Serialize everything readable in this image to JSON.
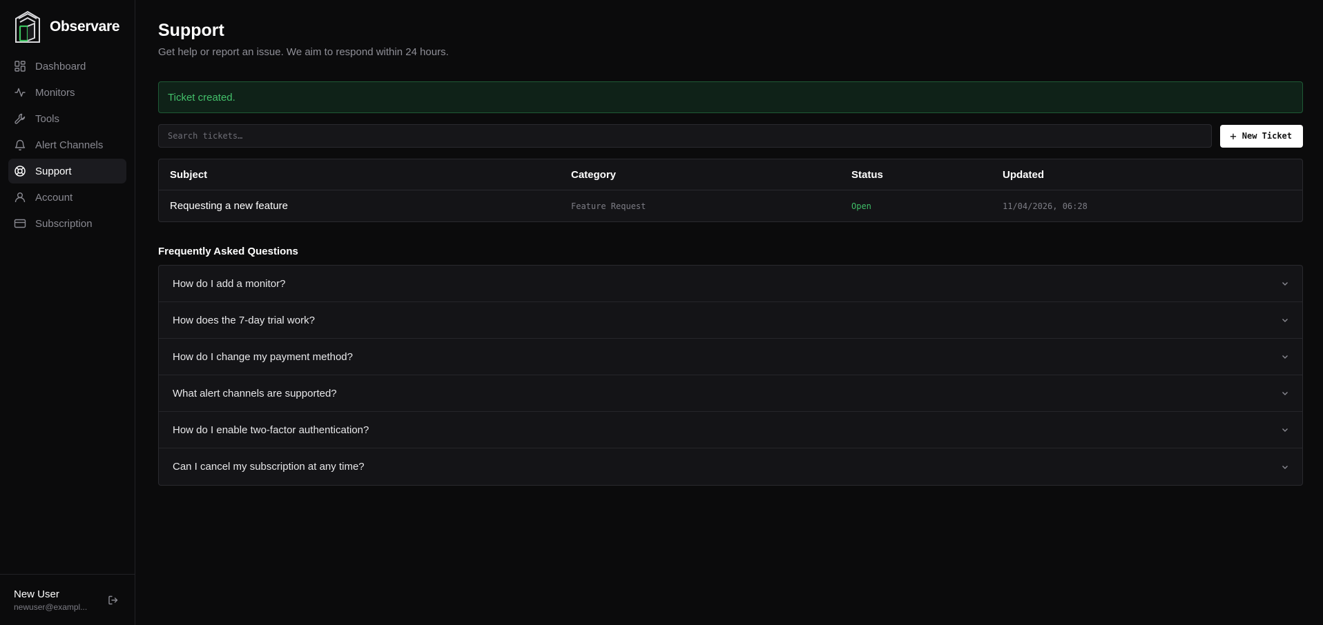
{
  "brand": {
    "name": "Observare"
  },
  "sidebar": {
    "items": [
      {
        "label": "Dashboard",
        "icon": "dashboard-icon"
      },
      {
        "label": "Monitors",
        "icon": "activity-icon"
      },
      {
        "label": "Tools",
        "icon": "wrench-icon"
      },
      {
        "label": "Alert Channels",
        "icon": "bell-icon"
      },
      {
        "label": "Support",
        "icon": "lifebuoy-icon",
        "active": true
      },
      {
        "label": "Account",
        "icon": "user-icon"
      },
      {
        "label": "Subscription",
        "icon": "credit-card-icon"
      }
    ]
  },
  "user": {
    "name": "New User",
    "email": "newuser@exampl..."
  },
  "page": {
    "title": "Support",
    "subtitle": "Get help or report an issue. We aim to respond within 24 hours."
  },
  "alert": {
    "message": "Ticket created."
  },
  "search": {
    "placeholder": "Search tickets…"
  },
  "toolbar": {
    "new_ticket_label": "New Ticket"
  },
  "tickets": {
    "columns": [
      "Subject",
      "Category",
      "Status",
      "Updated"
    ],
    "rows": [
      {
        "subject": "Requesting a new feature",
        "category": "Feature Request",
        "status": "Open",
        "updated": "11/04/2026, 06:28"
      }
    ]
  },
  "faq": {
    "title": "Frequently Asked Questions",
    "items": [
      "How do I add a monitor?",
      "How does the 7-day trial work?",
      "How do I change my payment method?",
      "What alert channels are supported?",
      "How do I enable two-factor authentication?",
      "Can I cancel my subscription at any time?"
    ]
  },
  "colors": {
    "accent_green": "#43c06a",
    "background": "#0b0b0c",
    "panel": "#141417"
  }
}
